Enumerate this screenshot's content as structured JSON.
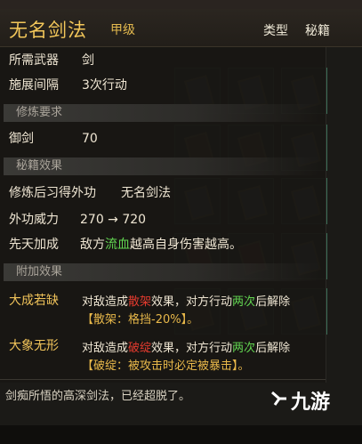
{
  "title": {
    "name": "无名剑法",
    "grade": "甲级",
    "type_label": "类型",
    "type_value": "秘籍"
  },
  "stats": [
    {
      "key": "所需武器",
      "value": "剑"
    },
    {
      "key": "施展间隔",
      "value": "3次行动"
    }
  ],
  "sections": {
    "requirement": "修炼要求",
    "effect": "秘籍效果",
    "extra": "附加效果"
  },
  "requirement": {
    "key": "御剑",
    "value": "70"
  },
  "effect_rows": {
    "learn_key": "修炼后习得外功",
    "learn_value": "无名剑法",
    "power_key": "外功威力",
    "power_value": "270 → 720",
    "innate_key": "先天加成",
    "innate_pre": "敌方",
    "innate_hl": "流血",
    "innate_post": "越高自身伤害越高。"
  },
  "extra_skills": [
    {
      "name": "大成若缺",
      "line_pre": "对敌造成",
      "line_hl": "散架",
      "line_mid": "效果，对方行动",
      "line_hl2": "两次",
      "line_post": "后解除",
      "sub": "【散架：格挡-20%】。"
    },
    {
      "name": "大象无形",
      "line_pre": "对敌造成",
      "line_hl": "破绽",
      "line_mid": "效果，对方行动",
      "line_hl2": "两次",
      "line_post": "后解除",
      "sub": "【破绽：被攻击时必定被暴击】。"
    }
  ],
  "description": "剑痴所悟的高深剑法，已经超脱了。",
  "watermark": "九游",
  "colors": {
    "gold": "#e7b943",
    "green": "#62d651",
    "red": "#e23a2e",
    "panel": "#181613"
  }
}
